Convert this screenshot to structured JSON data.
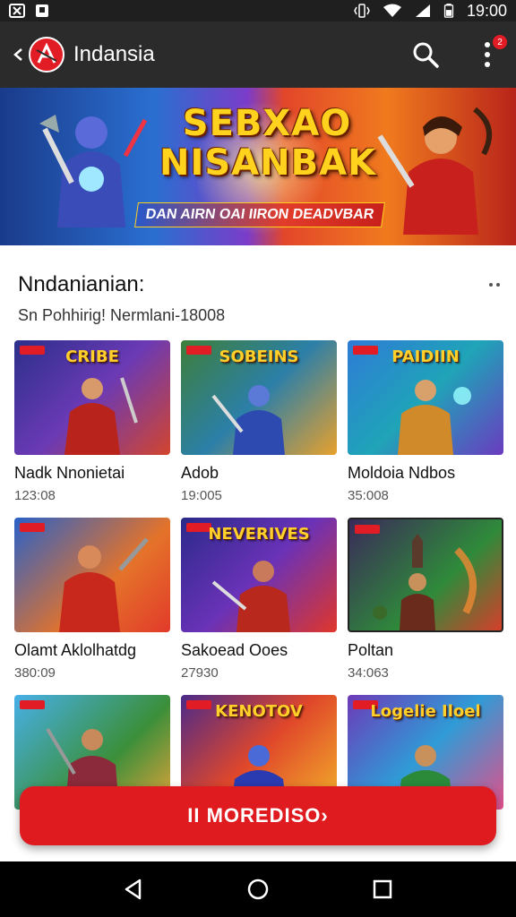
{
  "status_bar": {
    "time": "19:00",
    "icons": [
      "notification-x-icon",
      "notification-image-icon",
      "vibrate-icon",
      "wifi-icon",
      "signal-icon",
      "battery-icon"
    ]
  },
  "app_bar": {
    "title": "Indansia",
    "badge_count": "2",
    "icons": [
      "back-arrow-icon",
      "app-logo-icon",
      "search-icon",
      "more-vert-icon"
    ]
  },
  "banner": {
    "title_line1": "SEBXAO",
    "title_line2": "NISANBAK",
    "subtitle": "DAN AIRN OAI IIRON DEADVBAR"
  },
  "section": {
    "title": "Nndanianian:",
    "subtitle": "Sn Pohhirig! Nermlani-18008"
  },
  "games": [
    {
      "title": "Nadk Nnonietai",
      "meta": "123:08",
      "logo": "CRIBE"
    },
    {
      "title": "Adob",
      "meta": "19:005",
      "logo": "SOBEINS"
    },
    {
      "title": "Moldoia Ndbos",
      "meta": "35:008",
      "logo": "PAIDIIN"
    },
    {
      "title": "Olamt Aklolhatdg",
      "meta": "380:09",
      "logo": ""
    },
    {
      "title": "Sakoead Ooes",
      "meta": "27930",
      "logo": "NEVERIVES"
    },
    {
      "title": "Poltan",
      "meta": "34:063",
      "logo": ""
    },
    {
      "title": "",
      "meta": "",
      "logo": ""
    },
    {
      "title": "",
      "meta": "",
      "logo": "KENOTOV"
    },
    {
      "title": "",
      "meta": "",
      "logo": "Logelie Iloel"
    }
  ],
  "cta": {
    "label": "II MOREDISO›"
  },
  "nav_bar": {
    "icons": [
      "back-triangle-icon",
      "home-circle-icon",
      "recents-square-icon"
    ]
  },
  "colors": {
    "accent_red": "#e01b20",
    "app_bar_bg": "#2b2b2b",
    "status_bar_bg": "#1f1f1f"
  }
}
